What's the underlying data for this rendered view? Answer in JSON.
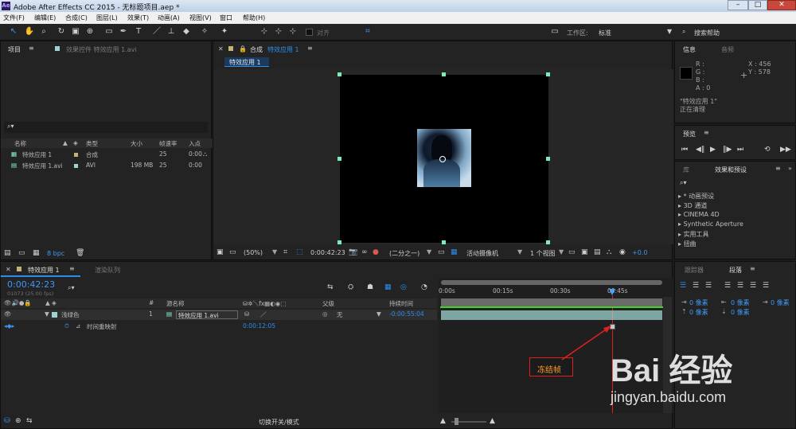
{
  "window": {
    "title": "Adobe After Effects CC 2015 - 无标题项目.aep *"
  },
  "menu": [
    "文件(F)",
    "编辑(E)",
    "合成(C)",
    "图层(L)",
    "效果(T)",
    "动画(A)",
    "视图(V)",
    "窗口",
    "帮助(H)"
  ],
  "toolbar": {
    "snap_label": "对齐",
    "workspace_label": "工作区:",
    "workspace_value": "标准",
    "search_help": "搜索帮助"
  },
  "project": {
    "tab": "项目",
    "effects_tab": "效果控件 特效应用 1.avi",
    "search_placeholder": "",
    "columns": [
      "名称",
      "类型",
      "大小",
      "帧速率",
      "入点"
    ],
    "items": [
      {
        "name": "特效应用 1",
        "type": "合成",
        "size": "",
        "fps": "25",
        "in": "0:00"
      },
      {
        "name": "特效应用 1.avi",
        "type": "AVI",
        "size": "198 MB",
        "fps": "25",
        "in": "0:00"
      }
    ],
    "bpc": "8 bpc"
  },
  "comp": {
    "tab": "合成",
    "tab_name": "特效应用 1",
    "sub_tab": "特效应用 1",
    "zoom": "(50%)",
    "timecode": "0:00:42:23",
    "resolution": "(二分之一)",
    "camera": "活动摄像机",
    "views": "1 个视图",
    "offset": "+0.0"
  },
  "info": {
    "tab": "信息",
    "audio_tab": "音频",
    "r": "R :",
    "g": "G :",
    "b": "B :",
    "a": "A : 0",
    "x": "X : 456",
    "y": "Y : 578",
    "layer": "\"特效应用 1\"",
    "status": "正在清理"
  },
  "preview": {
    "tab": "预览"
  },
  "effects": {
    "lib_tab": "库",
    "tab": "效果和预设",
    "items": [
      "* 动画预设",
      "3D 通道",
      "CINEMA 4D",
      "Synthetic Aperture",
      "实用工具",
      "扭曲"
    ]
  },
  "paragraph": {
    "tracker_tab": "跟踪器",
    "tab": "段落",
    "px": [
      "0 像素",
      "0 像素",
      "0 像素",
      "0 像素",
      "0 像素"
    ]
  },
  "timeline": {
    "comp_tab": "特效应用 1",
    "render_tab": "渲染队列",
    "timecode": "0:00:42:23",
    "frames": "01073 (25.00 fps)",
    "columns": {
      "num": "#",
      "source": "源名称",
      "parent": "父级",
      "duration": "持续时间"
    },
    "layer": {
      "label": "浅绿色",
      "num": "1",
      "name": "特效应用 1.avi",
      "parent": "无",
      "duration": "-0:00:55:04"
    },
    "remap": {
      "name": "时间重映射",
      "value": "0:00:12:05"
    },
    "ruler": [
      "0:00s",
      "00:15s",
      "00:30s",
      "00:45s"
    ],
    "switch_label": "切换开关/模式"
  },
  "annotation": {
    "text": "冻结帧"
  },
  "watermark": {
    "brand": "Bai 经验",
    "url": "jingyan.baidu.com"
  },
  "colors": {
    "accent": "#2d8ceb",
    "annotation": "#e02020",
    "label_green": "#9fd3cf"
  }
}
